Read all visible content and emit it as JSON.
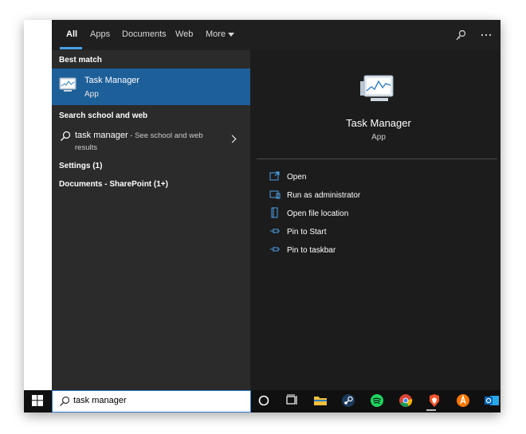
{
  "tabs": [
    "All",
    "Apps",
    "Documents",
    "Web",
    "More"
  ],
  "left": {
    "best_match_label": "Best match",
    "best_match": {
      "title": "Task Manager",
      "subtitle": "App"
    },
    "school_web_label": "Search school and web",
    "web_result": {
      "query": "task manager",
      "hint": " - See school and web",
      "hint2": "results"
    },
    "settings_label": "Settings (1)",
    "documents_label": "Documents - SharePoint (1+)"
  },
  "right": {
    "title": "Task Manager",
    "subtitle": "App",
    "actions": [
      "Open",
      "Run as administrator",
      "Open file location",
      "Pin to Start",
      "Pin to taskbar"
    ]
  },
  "search": {
    "value": "task manager"
  },
  "icons": {
    "start": "windows-start-icon",
    "feedback": "feedback-icon",
    "more": "ellipsis-icon",
    "cortana": "cortana-circle-icon",
    "task_view": "task-view-icon",
    "explorer": "file-explorer-icon",
    "steam": "steam-icon",
    "spotify": "spotify-icon",
    "chrome": "chrome-icon",
    "brave": "brave-icon",
    "avast": "avast-icon",
    "outlook": "outlook-icon"
  },
  "colors": {
    "accent": "#1d5f99",
    "tab_underline": "#4aa0e6"
  }
}
